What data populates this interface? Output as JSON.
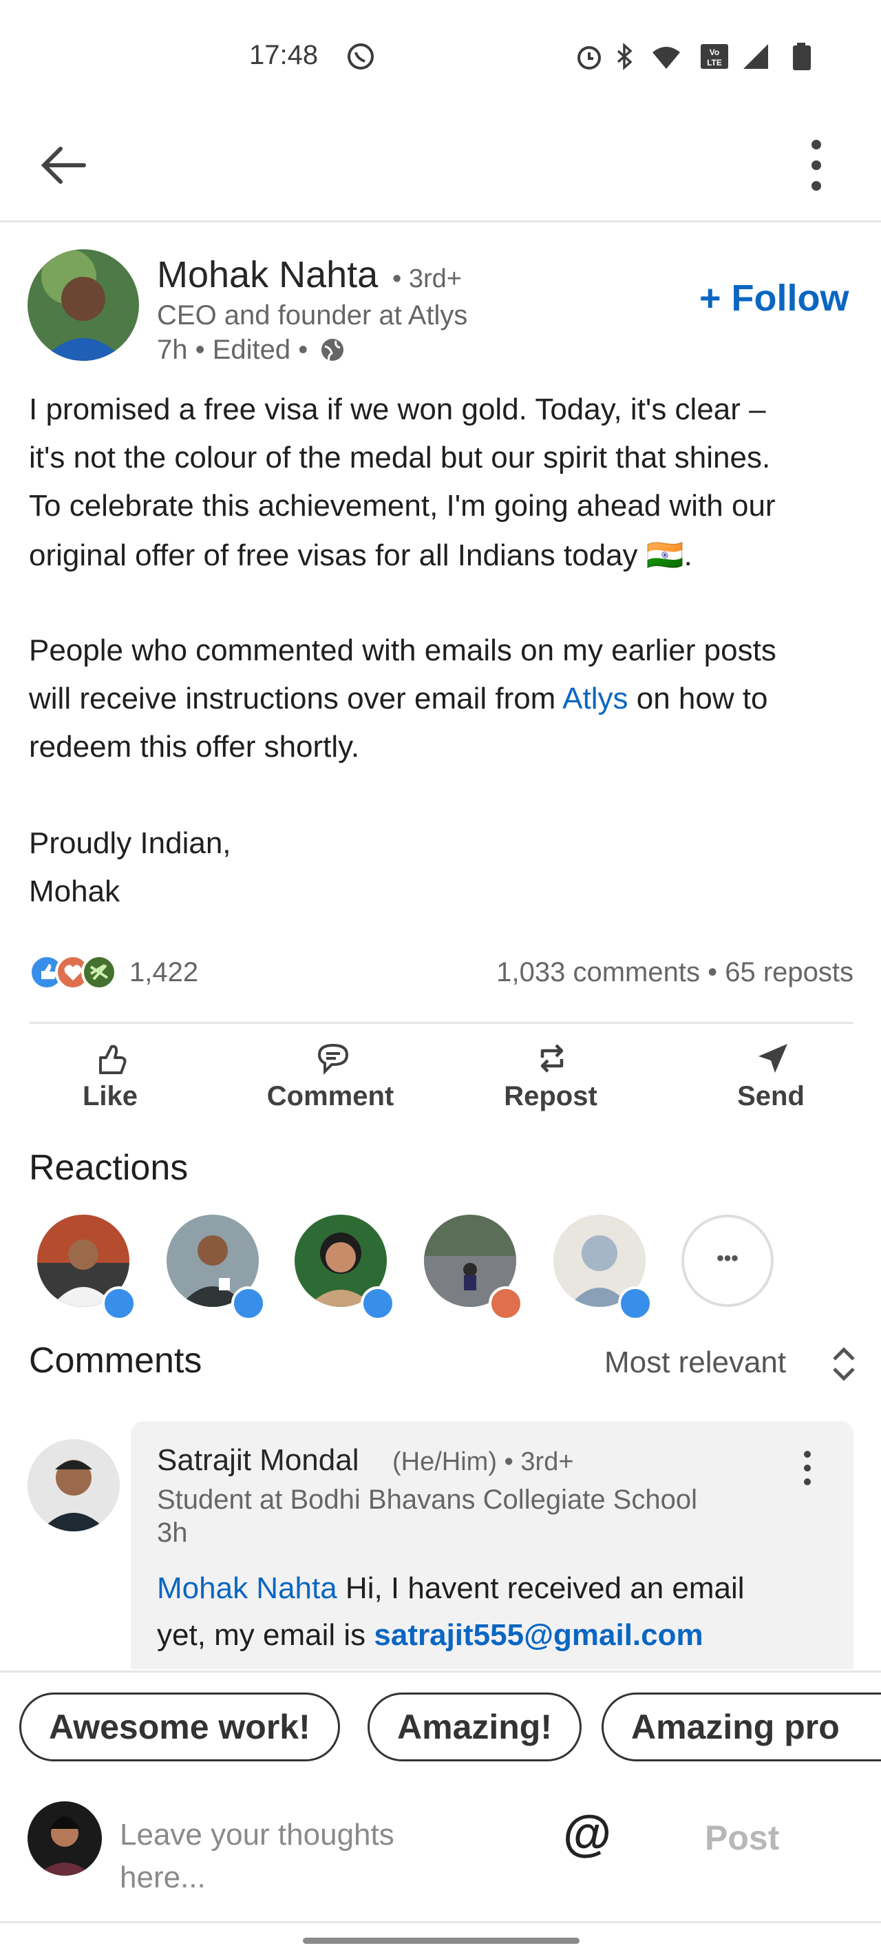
{
  "status_bar": {
    "time": "17:48",
    "icons": [
      "whatsapp-icon",
      "alarm-icon",
      "bluetooth-icon",
      "wifi-icon",
      "volte-icon",
      "signal-icon",
      "battery-icon"
    ]
  },
  "app_bar": {
    "back_icon": "arrow-left-icon",
    "menu_icon": "more-vertical-icon"
  },
  "post": {
    "author": {
      "name": "Mohak Nahta",
      "degree": "• 3rd+",
      "headline": "CEO and founder at Atlys",
      "meta": "7h • Edited •"
    },
    "follow_label": "+ Follow",
    "body": {
      "line1": "I promised a free visa if we won gold. Today, it's clear –",
      "line2": "it's not the colour of the medal but our spirit that shines.",
      "line3": "To celebrate this achievement, I'm going ahead with our",
      "line4_pre": "original offer of free visas for all Indians today",
      "line4_flag": "🇮🇳",
      "line4_post": ".",
      "line5": "People who commented with emails on my earlier posts",
      "line6_pre": "will receive  instructions over email from ",
      "line6_link": "Atlys",
      "line6_post": " on how to",
      "line7": "redeem this offer shortly.",
      "line8": "Proudly Indian,",
      "line9": "Mohak"
    },
    "reaction_count": "1,422",
    "comments_reposts": "1,033 comments • 65 reposts",
    "actions": {
      "like": "Like",
      "comment": "Comment",
      "repost": "Repost",
      "send": "Send"
    }
  },
  "reactions": {
    "title": "Reactions",
    "more_label": "•••"
  },
  "comments": {
    "title": "Comments",
    "sort_label": "Most relevant",
    "first": {
      "name": "Satrajit Mondal",
      "pronoun": "(He/Him) • 3rd+",
      "headline": "Student at Bodhi Bhavans Collegiate School",
      "time": "3h",
      "mention": "Mohak Nahta",
      "text1": " Hi, I havent received an email",
      "text2_pre": "yet, my email is ",
      "email": "satrajit555@gmail.com"
    }
  },
  "suggestions": [
    "Awesome work!",
    "Amazing!",
    "Amazing pro"
  ],
  "composer": {
    "placeholder_line1": "Leave your thoughts",
    "placeholder_line2": "here...",
    "mention": "@",
    "post": "Post"
  },
  "colors": {
    "link": "#0a66c2",
    "like": "#378fe9",
    "love": "#df704d",
    "support": "#44712e"
  }
}
